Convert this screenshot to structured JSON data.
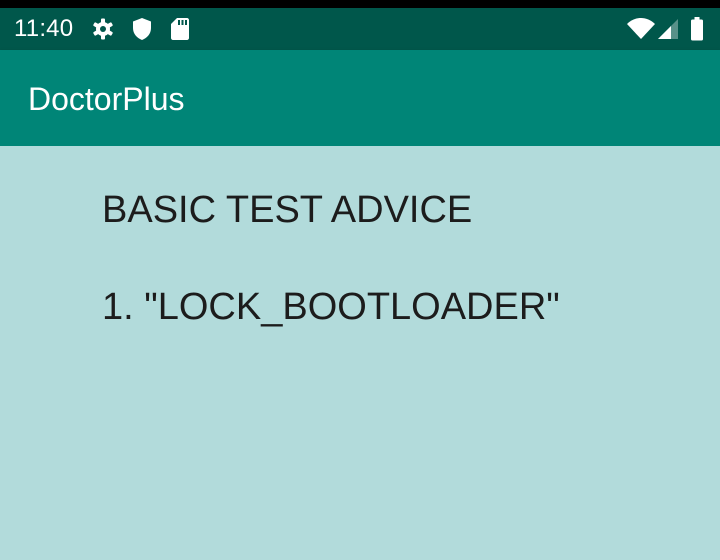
{
  "status_bar": {
    "time": "11:40",
    "icons": [
      "settings-gear-icon",
      "shield-icon",
      "sd-card-icon",
      "wifi-icon",
      "cell-signal-icon",
      "battery-icon"
    ]
  },
  "app_bar": {
    "title": "DoctorPlus"
  },
  "content": {
    "heading": "BASIC TEST ADVICE",
    "items": [
      "1. \"LOCK_BOOTLOADER\""
    ]
  },
  "colors": {
    "status_bar": "#00574b",
    "app_bar": "#008577",
    "background": "#b2dbdb",
    "text": "#1c1c1c"
  }
}
